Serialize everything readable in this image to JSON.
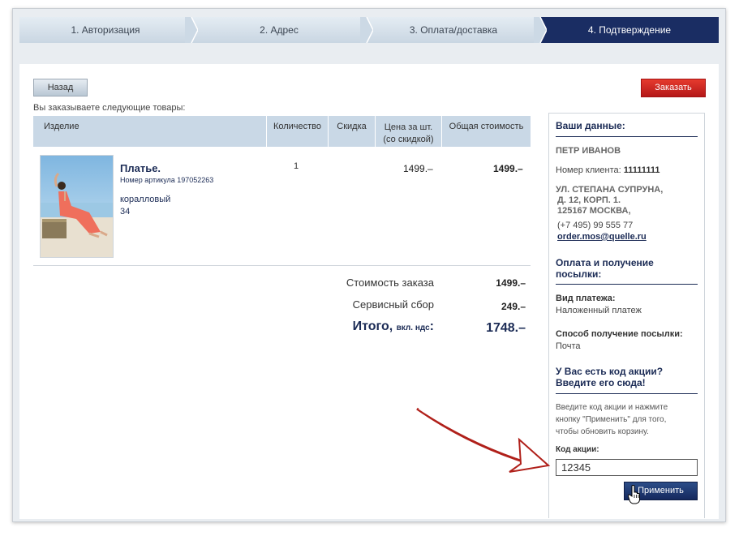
{
  "steps": [
    {
      "label": "1. Авторизация"
    },
    {
      "label": "2. Адрес"
    },
    {
      "label": "3. Оплата/доставка"
    },
    {
      "label": "4. Подтверждение"
    }
  ],
  "buttons": {
    "back": "Назад",
    "order": "Заказать",
    "apply": "Применить"
  },
  "intro": "Вы заказываете следующие товары:",
  "table": {
    "headers": {
      "item": "Изделие",
      "qty": "Количество",
      "discount": "Скидка",
      "price_line1": "Цена за шт.",
      "price_line2": "(со скидкой)",
      "total": "Общая стоимость"
    },
    "rows": [
      {
        "name": "Платье.",
        "article": "Номер артикула 197052263",
        "color": "коралловый",
        "size": "34",
        "qty": "1",
        "discount": "",
        "price": "1499.–",
        "total": "1499.–"
      }
    ]
  },
  "summary": {
    "order_cost_label": "Стоимость заказа",
    "order_cost": "1499.–",
    "service_label": "Сервисный сбор",
    "service": "249.–",
    "total_label": "Итого,",
    "total_vat": "вкл. ндс",
    "total_colon": ":",
    "total": "1748.–"
  },
  "sidebar": {
    "your_data": "Ваши данные:",
    "name": "ПЕТР ИВАНОВ",
    "client_label": "Номер клиента:",
    "client_number": "11111111",
    "address_line1": "УЛ. СТЕПАНА СУПРУНА,",
    "address_line2": "Д. 12, КОРП. 1.",
    "address_line3": "125167 МОСКВА,",
    "phone": "(+7 495) 99 555 77",
    "email": "order.mos@quelle.ru",
    "payment_heading_line1": "Оплата и получение",
    "payment_heading_line2": "посылки:",
    "payment_type_label": "Вид платежа:",
    "payment_type": "Наложенный платеж",
    "delivery_label": "Способ получение посылки:",
    "delivery": "Почта",
    "promo_heading_line1": "У Вас есть код акции?",
    "promo_heading_line2": "Введите его сюда!",
    "promo_hint_line1": "Введите код акции и нажмите",
    "promo_hint_line2": "кнопку \"Применить\" для того,",
    "promo_hint_line3": "чтобы обновить корзину.",
    "promo_label": "Код акции:",
    "promo_value": "12345"
  },
  "colors": {
    "accent": "#1a2d63",
    "order_button": "#c62020",
    "step_inactive": "#d3dfea"
  }
}
